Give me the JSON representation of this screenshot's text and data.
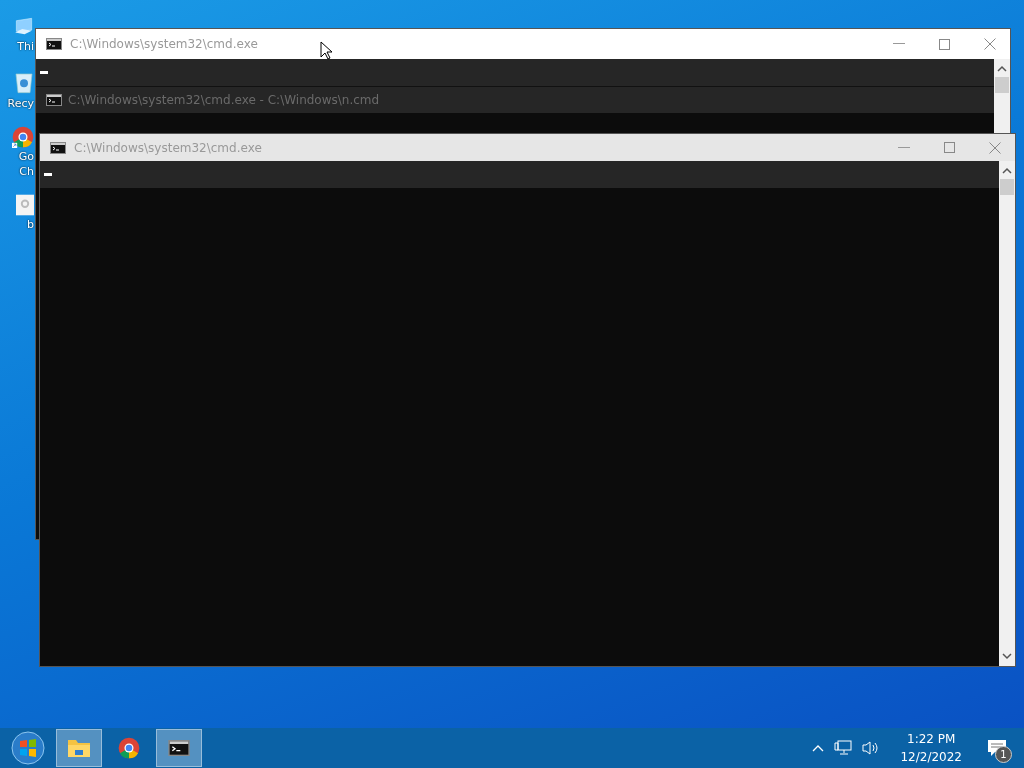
{
  "desktop_icons": [
    {
      "kind": "pc",
      "label_lines": [
        "Thi"
      ]
    },
    {
      "kind": "recycle",
      "label_lines": [
        "Recy"
      ]
    },
    {
      "kind": "chrome",
      "label_lines": [
        "Go",
        "Ch"
      ]
    },
    {
      "kind": "file",
      "label_lines": [
        "b"
      ]
    }
  ],
  "back_window": {
    "title": "C:\\Windows\\system32\\cmd.exe",
    "ghost_rows": [
      {
        "title": "C:\\Windows\\system32\\cmd.exe - C:\\Windows\\n.cmd"
      }
    ]
  },
  "front_window": {
    "title": "C:\\Windows\\system32\\cmd.exe"
  },
  "taskbar": {
    "apps": [
      {
        "kind": "explorer",
        "selected": true
      },
      {
        "kind": "chrome",
        "selected": false
      },
      {
        "kind": "cmd",
        "selected": true
      }
    ],
    "time": "1:22 PM",
    "date": "12/2/2022",
    "notification_count": "1"
  }
}
